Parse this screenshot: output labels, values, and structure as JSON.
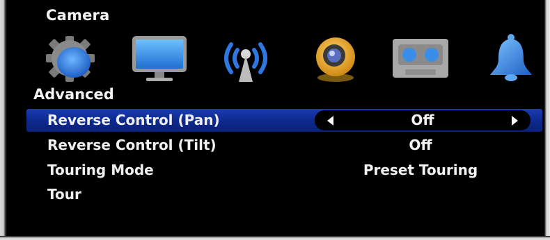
{
  "header": {
    "title": "Camera"
  },
  "icons": [
    {
      "name": "gear-icon"
    },
    {
      "name": "monitor-icon"
    },
    {
      "name": "wireless-icon"
    },
    {
      "name": "webcam-icon"
    },
    {
      "name": "tape-icon"
    },
    {
      "name": "bell-icon"
    }
  ],
  "section": {
    "label": "Advanced"
  },
  "menu": {
    "items": [
      {
        "label": "Reverse Control (Pan)",
        "value": "Off"
      },
      {
        "label": "Reverse Control (Tilt)",
        "value": "Off"
      },
      {
        "label": "Touring Mode",
        "value": "Preset Touring"
      },
      {
        "label": "Tour",
        "value": ""
      }
    ]
  },
  "colors": {
    "background": "#000000",
    "selection": "#1a3cb0",
    "text": "#f0f0f0"
  }
}
